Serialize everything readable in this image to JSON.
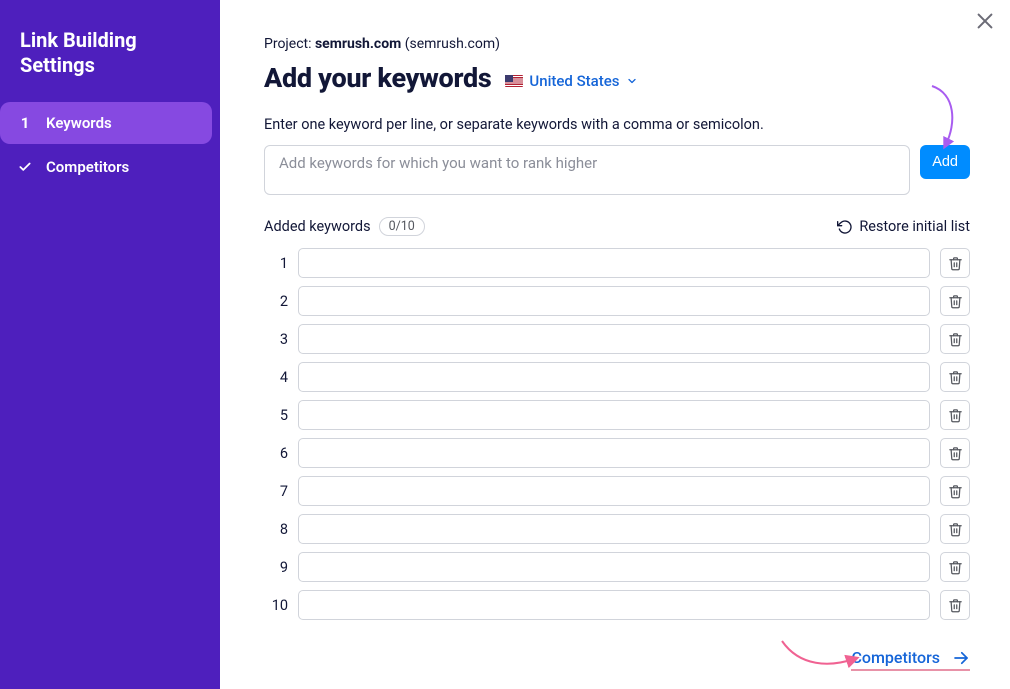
{
  "sidebar": {
    "title": "Link Building Settings",
    "items": [
      {
        "index": "1",
        "label": "Keywords",
        "active": true
      },
      {
        "index": "check",
        "label": "Competitors",
        "active": false
      }
    ]
  },
  "header": {
    "project_prefix": "Project: ",
    "project_name": "semrush.com",
    "project_domain": " (semrush.com)",
    "title": "Add your keywords",
    "locale": "United States"
  },
  "instructions": "Enter one keyword per line, or separate keywords with a comma or semicolon.",
  "keyword_input_placeholder": "Add keywords for which you want to rank higher",
  "add_button": "Add",
  "added": {
    "label": "Added keywords",
    "count": "0/10",
    "restore": "Restore initial list"
  },
  "rows": [
    {
      "n": "1",
      "value": ""
    },
    {
      "n": "2",
      "value": ""
    },
    {
      "n": "3",
      "value": ""
    },
    {
      "n": "4",
      "value": ""
    },
    {
      "n": "5",
      "value": ""
    },
    {
      "n": "6",
      "value": ""
    },
    {
      "n": "7",
      "value": ""
    },
    {
      "n": "8",
      "value": ""
    },
    {
      "n": "9",
      "value": ""
    },
    {
      "n": "10",
      "value": ""
    }
  ],
  "footer": {
    "next_label": "Competitors"
  }
}
